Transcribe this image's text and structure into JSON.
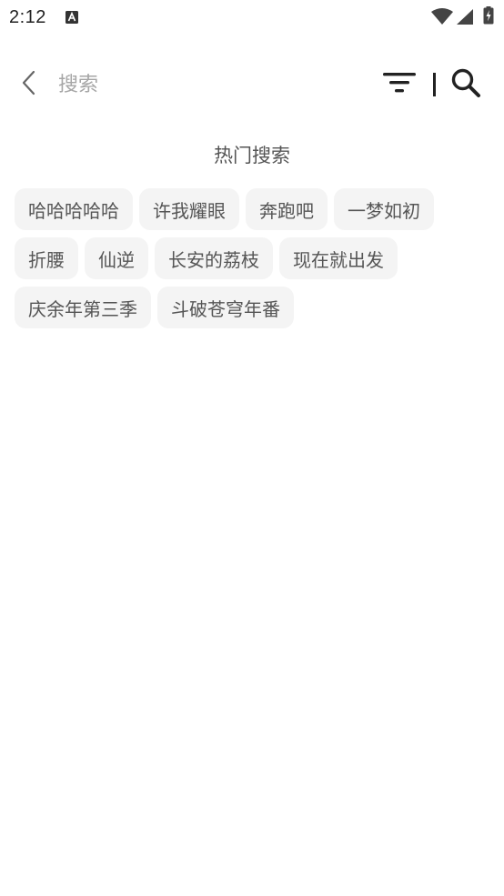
{
  "status_bar": {
    "time": "2:12"
  },
  "header": {
    "search_placeholder": "搜索",
    "search_value": ""
  },
  "hot_search": {
    "title": "热门搜索",
    "tags": [
      "哈哈哈哈哈",
      "许我耀眼",
      "奔跑吧",
      "一梦如初",
      "折腰",
      "仙逆",
      "长安的荔枝",
      "现在就出发",
      "庆余年第三季",
      "斗破苍穹年番"
    ]
  },
  "icons": {
    "back": "chevron-left-icon",
    "filter": "filter-icon",
    "search": "search-icon",
    "wifi": "wifi-icon",
    "signal": "signal-icon",
    "battery": "battery-charging-icon",
    "notification": "a-notification-icon"
  },
  "colors": {
    "tag_background": "#f4f4f4",
    "text": "#555555",
    "placeholder": "#a6a6a6",
    "icon": "#222222"
  }
}
